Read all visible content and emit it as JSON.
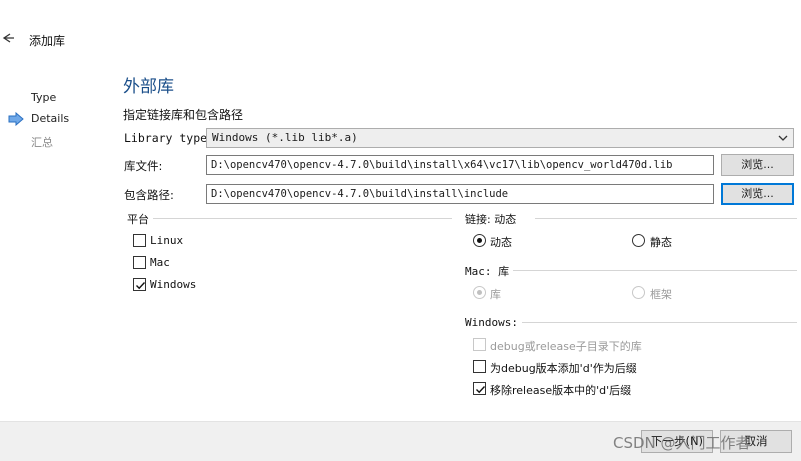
{
  "header": {
    "title": "添加库",
    "back_icon": "back-arrow-icon"
  },
  "nav": {
    "items": [
      {
        "label": "Type",
        "active": false
      },
      {
        "label": "Details",
        "active": true
      },
      {
        "label": "汇总",
        "active": false
      }
    ],
    "current_icon": "right-arrow-icon"
  },
  "main": {
    "heading": "外部库",
    "subheading": "指定链接库和包含路径",
    "library_type": {
      "label": "Library type:",
      "value": "Windows (*.lib lib*.a)"
    },
    "library_file": {
      "label": "库文件:",
      "value": "D:\\opencv470\\opencv-4.7.0\\build\\install\\x64\\vc17\\lib\\opencv_world470d.lib",
      "browse": "浏览..."
    },
    "include_path": {
      "label": "包含路径:",
      "value": "D:\\opencv470\\opencv-4.7.0\\build\\install\\include",
      "browse": "浏览..."
    }
  },
  "platform": {
    "title": "平台",
    "options": [
      {
        "label": "Linux",
        "checked": false
      },
      {
        "label": "Mac",
        "checked": false
      },
      {
        "label": "Windows",
        "checked": true
      }
    ]
  },
  "linkage": {
    "title": "链接: 动态",
    "options": [
      {
        "label": "动态",
        "selected": true
      },
      {
        "label": "静态",
        "selected": false
      }
    ]
  },
  "mac_lib": {
    "title": "Mac: 库",
    "options": [
      {
        "label": "库",
        "selected": true,
        "disabled": true
      },
      {
        "label": "框架",
        "selected": false,
        "disabled": true
      }
    ]
  },
  "windows": {
    "title": "Windows:",
    "options": [
      {
        "label": "debug或release子目录下的库",
        "checked": false,
        "disabled": true
      },
      {
        "label": "为debug版本添加'd'作为后缀",
        "checked": false,
        "disabled": false
      },
      {
        "label": "移除release版本中的'd'后缀",
        "checked": true,
        "disabled": false
      }
    ]
  },
  "footer": {
    "next": "下一步(N)",
    "cancel": "取消",
    "watermark": "CSDN @入门工作者"
  }
}
